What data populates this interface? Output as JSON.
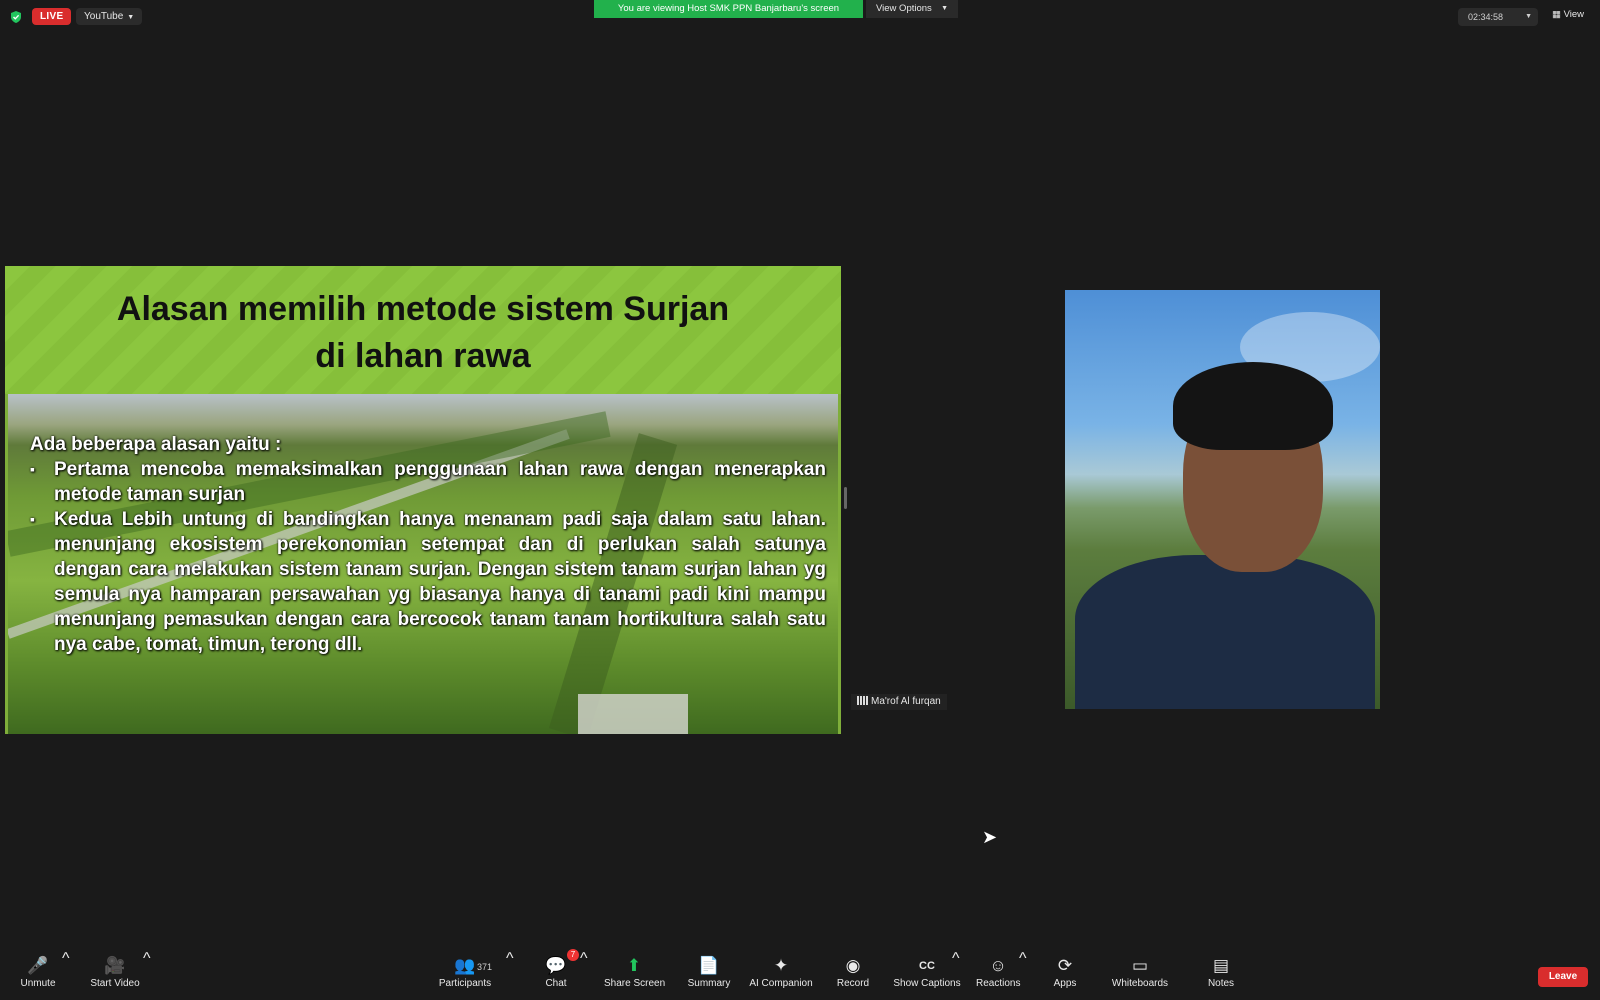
{
  "topbar": {
    "live_label": "LIVE",
    "stream_target": "YouTube",
    "banner": "You are viewing Host SMK PPN Banjarbaru's screen",
    "view_options": "View Options",
    "elapsed": "02:34:58",
    "view_label": "View"
  },
  "slide": {
    "title_line1": "Alasan memilih metode sistem Surjan",
    "title_line2": "di lahan rawa",
    "intro": "Ada beberapa alasan yaitu :",
    "bullets": [
      "Pertama mencoba memaksimalkan penggunaan lahan rawa dengan menerapkan metode taman surjan",
      "Kedua Lebih untung di bandingkan hanya menanam padi saja dalam satu lahan. menunjang ekosistem perekonomian setempat dan di perlukan salah satunya dengan cara melakukan sistem tanam surjan. Dengan sistem tanam surjan lahan yg semula nya hamparan persawahan yg biasanya hanya di tanami padi kini mampu menunjang pemasukan dengan cara bercocok tanam tanam hortikultura salah satu nya cabe, tomat, timun, terong dll."
    ]
  },
  "participant": {
    "name": "Ma'rof Al furqan"
  },
  "toolbar": {
    "unmute": "Unmute",
    "start_video": "Start Video",
    "participants": "Participants",
    "participants_count": "371",
    "chat": "Chat",
    "chat_badge": "7",
    "share_screen": "Share Screen",
    "summary": "Summary",
    "ai_companion": "AI Companion",
    "record": "Record",
    "show_captions": "Show Captions",
    "reactions": "Reactions",
    "apps": "Apps",
    "whiteboards": "Whiteboards",
    "notes": "Notes",
    "leave": "Leave"
  },
  "colors": {
    "live": "#d92d2d",
    "banner": "#22b14c",
    "slide_header": "#8cc63f",
    "leave": "#d92d2d"
  },
  "icons": [
    "shield-icon",
    "mic-muted-icon",
    "video-off-icon",
    "participants-icon",
    "chat-icon",
    "share-screen-icon",
    "summary-icon",
    "ai-companion-icon",
    "record-icon",
    "captions-icon",
    "reactions-icon",
    "apps-icon",
    "whiteboard-icon",
    "notes-icon"
  ]
}
